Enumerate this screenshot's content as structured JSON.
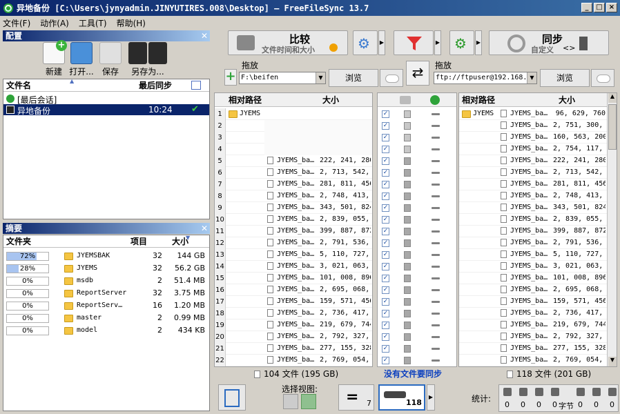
{
  "window": {
    "title": "异地备份 [C:\\Users\\jynyadmin.JINYUTIRES.008\\Desktop] – FreeFileSync 13.7"
  },
  "menu": [
    "文件(F)",
    "动作(A)",
    "工具(T)",
    "帮助(H)"
  ],
  "config": {
    "header": "配置",
    "tools": {
      "new": "新建",
      "open": "打开...",
      "save": "保存",
      "save_as": "另存为..."
    },
    "columns": {
      "name": "文件名",
      "last_sync": "最后同步"
    },
    "items": [
      {
        "name": "[最后会话]",
        "time": ""
      },
      {
        "name": "异地备份",
        "time": "10:24"
      }
    ]
  },
  "summary": {
    "header": "摘要",
    "columns": {
      "folder": "文件夹",
      "items": "项目",
      "size": "大小"
    },
    "rows": [
      {
        "pct": "72%",
        "fill": 0.72,
        "name": "JYEMSBAK",
        "items": "32",
        "size": "144 GB"
      },
      {
        "pct": "28%",
        "fill": 0.28,
        "name": "JYEMS",
        "items": "32",
        "size": "56.2 GB"
      },
      {
        "pct": "0%",
        "fill": 0,
        "name": "msdb",
        "items": "2",
        "size": "51.4 MB"
      },
      {
        "pct": "0%",
        "fill": 0,
        "name": "ReportServer",
        "items": "32",
        "size": "3.75 MB"
      },
      {
        "pct": "0%",
        "fill": 0,
        "name": "ReportServ…",
        "items": "16",
        "size": "1.20 MB"
      },
      {
        "pct": "0%",
        "fill": 0,
        "name": "master",
        "items": "2",
        "size": "0.99 MB"
      },
      {
        "pct": "0%",
        "fill": 0,
        "name": "model",
        "items": "2",
        "size": "434 KB"
      }
    ]
  },
  "toolbar": {
    "compare_label": "比较",
    "compare_sub": "文件时间和大小",
    "sync_label": "同步",
    "sync_sub": "自定义"
  },
  "folders": {
    "drop_label": "拖放",
    "left_path": "F:\\beifen",
    "right_path": "ftp://ftpuser@192.168.",
    "browse": "浏览"
  },
  "grid": {
    "rel_path": "相对路径",
    "size": "大小",
    "folder_name": "JYEMS",
    "left_rows": [
      {
        "n": "1",
        "name": "",
        "size": "",
        "folder": true
      },
      {
        "n": "2",
        "name": "",
        "size": ""
      },
      {
        "n": "3",
        "name": "",
        "size": ""
      },
      {
        "n": "4",
        "name": "",
        "size": ""
      },
      {
        "n": "5",
        "name": "JYEMS_ba…",
        "size": "222, 241, 280"
      },
      {
        "n": "6",
        "name": "JYEMS_ba…",
        "size": "2, 713, 542, …"
      },
      {
        "n": "7",
        "name": "JYEMS_ba…",
        "size": "281, 811, 456"
      },
      {
        "n": "8",
        "name": "JYEMS_ba…",
        "size": "2, 748, 413, …"
      },
      {
        "n": "9",
        "name": "JYEMS_ba…",
        "size": "343, 501, 824"
      },
      {
        "n": "10",
        "name": "JYEMS_ba…",
        "size": "2, 839, 055, …"
      },
      {
        "n": "11",
        "name": "JYEMS_ba…",
        "size": "399, 887, 872"
      },
      {
        "n": "12",
        "name": "JYEMS_ba…",
        "size": "2, 791, 536, …"
      },
      {
        "n": "13",
        "name": "JYEMS_ba…",
        "size": "5, 110, 727, …"
      },
      {
        "n": "14",
        "name": "JYEMS_ba…",
        "size": "3, 021, 063, …"
      },
      {
        "n": "15",
        "name": "JYEMS_ba…",
        "size": "101, 008, 896"
      },
      {
        "n": "16",
        "name": "JYEMS_ba…",
        "size": "2, 695, 068, …"
      },
      {
        "n": "17",
        "name": "JYEMS_ba…",
        "size": "159, 571, 456"
      },
      {
        "n": "18",
        "name": "JYEMS_ba…",
        "size": "2, 736, 417, …"
      },
      {
        "n": "19",
        "name": "JYEMS_ba…",
        "size": "219, 679, 744"
      },
      {
        "n": "20",
        "name": "JYEMS_ba…",
        "size": "2, 792, 327, …"
      },
      {
        "n": "21",
        "name": "JYEMS_ba…",
        "size": "277, 155, 328"
      },
      {
        "n": "22",
        "name": "JYEMS_ba…",
        "size": "2, 769, 054, …"
      }
    ],
    "right_rows": [
      {
        "name": "JYEMS_ba…",
        "size": "96, 629, 760"
      },
      {
        "name": "JYEMS_ba…",
        "size": "2, 751, 300, …"
      },
      {
        "name": "JYEMS_ba…",
        "size": "160, 563, 200"
      },
      {
        "name": "JYEMS_ba…",
        "size": "2, 754, 117, …"
      },
      {
        "name": "JYEMS_ba…",
        "size": "222, 241, 280"
      },
      {
        "name": "JYEMS_ba…",
        "size": "2, 713, 542, …"
      },
      {
        "name": "JYEMS_ba…",
        "size": "281, 811, 456"
      },
      {
        "name": "JYEMS_ba…",
        "size": "2, 748, 413, …"
      },
      {
        "name": "JYEMS_ba…",
        "size": "343, 501, 824"
      },
      {
        "name": "JYEMS_ba…",
        "size": "2, 839, 055, …"
      },
      {
        "name": "JYEMS_ba…",
        "size": "399, 887, 872"
      },
      {
        "name": "JYEMS_ba…",
        "size": "2, 791, 536, …"
      },
      {
        "name": "JYEMS_ba…",
        "size": "5, 110, 727, …"
      },
      {
        "name": "JYEMS_ba…",
        "size": "3, 021, 063, …"
      },
      {
        "name": "JYEMS_ba…",
        "size": "101, 008, 896"
      },
      {
        "name": "JYEMS_ba…",
        "size": "2, 695, 068, …"
      },
      {
        "name": "JYEMS_ba…",
        "size": "159, 571, 456"
      },
      {
        "name": "JYEMS_ba…",
        "size": "2, 736, 417, …"
      },
      {
        "name": "JYEMS_ba…",
        "size": "219, 679, 744"
      },
      {
        "name": "JYEMS_ba…",
        "size": "2, 792, 327, …"
      },
      {
        "name": "JYEMS_ba…",
        "size": "277, 155, 328"
      },
      {
        "name": "JYEMS_ba…",
        "size": "2, 769, 054, …"
      }
    ]
  },
  "status": {
    "left": "104 文件 (195 GB)",
    "middle": "没有文件要同步",
    "right": "118 文件 (201 GB)"
  },
  "bottom": {
    "select_view": "选择视图:",
    "equal_count": "7",
    "total_count": "118",
    "stats_label": "统计:",
    "stats": [
      "0",
      "0",
      "0",
      "0",
      "0",
      "0",
      "0"
    ],
    "bytes_label": "字节"
  },
  "colors": {
    "title_blue": "#0a246a",
    "accent": "#1a4da0",
    "status_blue": "#0b3fbf"
  }
}
